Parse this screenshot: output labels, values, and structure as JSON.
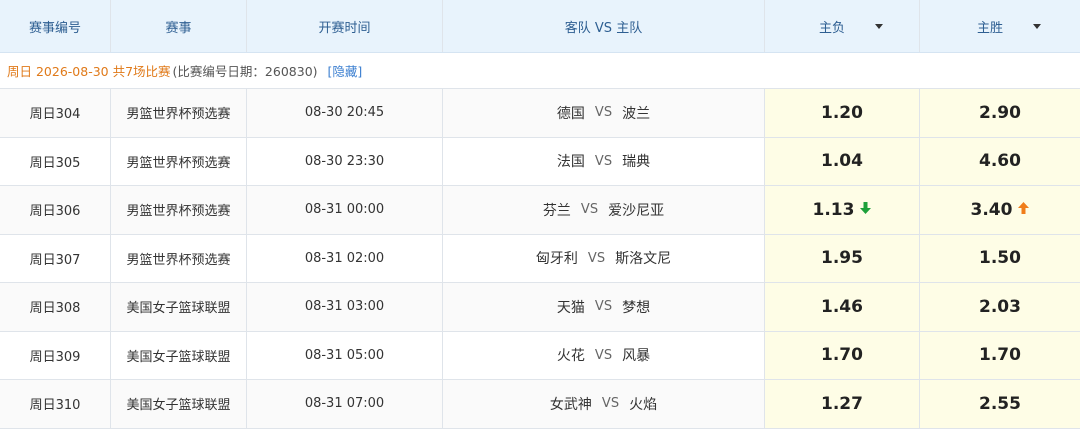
{
  "header": {
    "col_id": "赛事编号",
    "col_league": "赛事",
    "col_time": "开赛时间",
    "col_teams": "客队 VS 主队",
    "col_lose": "主负",
    "col_win": "主胜"
  },
  "date_bar": {
    "main": "周日 2026-08-30 共7场比赛",
    "sub": "(比赛编号日期：260830)",
    "hide": "[隐藏]"
  },
  "vs_label": "VS",
  "colors": {
    "header_bg": "#e8f3fc",
    "header_text": "#2e5f92",
    "date_accent": "#e07a1a",
    "link": "#3c7fd0",
    "odds_bg": "#fefde6",
    "arrow_down": "#1da03a",
    "arrow_up": "#f07d1a"
  },
  "rows": [
    {
      "id": "周日304",
      "league": "男篮世界杯预选赛",
      "time": "08-30 20:45",
      "away": "德国",
      "home": "波兰",
      "lose": "1.20",
      "win": "2.90",
      "lose_trend": "",
      "win_trend": ""
    },
    {
      "id": "周日305",
      "league": "男篮世界杯预选赛",
      "time": "08-30 23:30",
      "away": "法国",
      "home": "瑞典",
      "lose": "1.04",
      "win": "4.60",
      "lose_trend": "",
      "win_trend": ""
    },
    {
      "id": "周日306",
      "league": "男篮世界杯预选赛",
      "time": "08-31 00:00",
      "away": "芬兰",
      "home": "爱沙尼亚",
      "lose": "1.13",
      "win": "3.40",
      "lose_trend": "down",
      "win_trend": "up"
    },
    {
      "id": "周日307",
      "league": "男篮世界杯预选赛",
      "time": "08-31 02:00",
      "away": "匈牙利",
      "home": "斯洛文尼",
      "lose": "1.95",
      "win": "1.50",
      "lose_trend": "",
      "win_trend": ""
    },
    {
      "id": "周日308",
      "league": "美国女子篮球联盟",
      "time": "08-31 03:00",
      "away": "天猫",
      "home": "梦想",
      "lose": "1.46",
      "win": "2.03",
      "lose_trend": "",
      "win_trend": ""
    },
    {
      "id": "周日309",
      "league": "美国女子篮球联盟",
      "time": "08-31 05:00",
      "away": "火花",
      "home": "风暴",
      "lose": "1.70",
      "win": "1.70",
      "lose_trend": "",
      "win_trend": ""
    },
    {
      "id": "周日310",
      "league": "美国女子篮球联盟",
      "time": "08-31 07:00",
      "away": "女武神",
      "home": "火焰",
      "lose": "1.27",
      "win": "2.55",
      "lose_trend": "",
      "win_trend": ""
    }
  ]
}
